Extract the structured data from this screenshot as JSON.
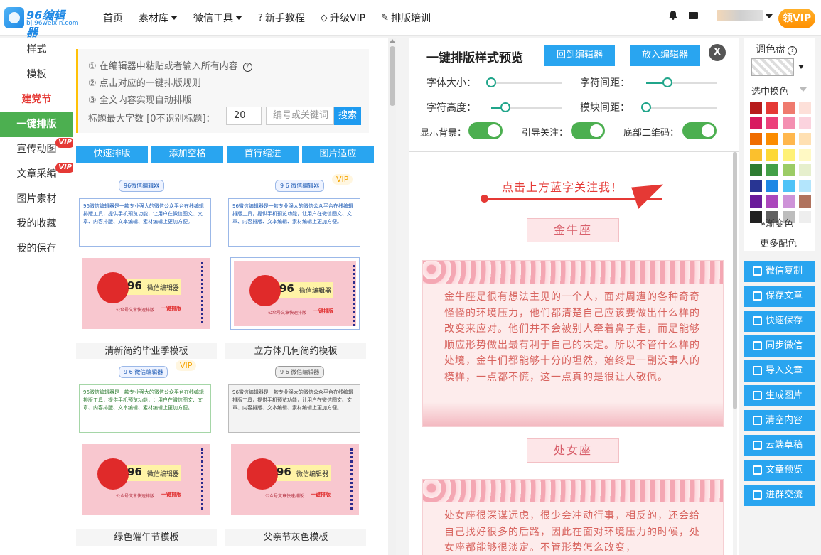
{
  "header": {
    "logo_title": "96编辑器",
    "logo_sub": "bj.96weixin.com",
    "nav": [
      {
        "label": "首页",
        "icon": "",
        "dropdown": false
      },
      {
        "label": "素材库",
        "icon": "",
        "dropdown": true
      },
      {
        "label": "微信工具",
        "icon": "",
        "dropdown": true
      },
      {
        "label": "新手教程",
        "icon": "question-icon",
        "dropdown": false
      },
      {
        "label": "升级VIP",
        "icon": "diamond-icon",
        "dropdown": false
      },
      {
        "label": "排版培训",
        "icon": "edit-icon",
        "dropdown": false
      }
    ],
    "vip_button": "领VIP"
  },
  "sidebar": {
    "items": [
      {
        "label": "样式",
        "state": "normal",
        "vip": false
      },
      {
        "label": "模板",
        "state": "normal",
        "vip": false
      },
      {
        "label": "建党节",
        "state": "highlight",
        "vip": false
      },
      {
        "label": "一键排版",
        "state": "active",
        "vip": false
      },
      {
        "label": "宣传动图",
        "state": "normal",
        "vip": true
      },
      {
        "label": "文章采编",
        "state": "normal",
        "vip": true
      },
      {
        "label": "图片素材",
        "state": "normal",
        "vip": false
      },
      {
        "label": "我的收藏",
        "state": "normal",
        "vip": false
      },
      {
        "label": "我的保存",
        "state": "normal",
        "vip": false
      }
    ],
    "vip_tag": "VIP"
  },
  "templates": {
    "hints": [
      "① 在编辑器中粘贴或者输入所有内容",
      "② 点击对应的一键排版规则",
      "③ 全文内容实现自动排版"
    ],
    "max_label": "标题最大字数 [0不识别标题]：",
    "max_value": "20",
    "keyword_placeholder": "编号或关键词",
    "search_label": "搜索",
    "quick_buttons": [
      "快速排版",
      "添加空格",
      "首行缩进",
      "图片适应"
    ],
    "vip_label": "VIP",
    "poster": {
      "num": "96",
      "name": "微信编辑器",
      "sub": "公众号文章快速排版",
      "tag": "一键排版",
      "head": "96微信编辑器",
      "head_spaced": "9 6 微信编辑器",
      "blurb": "96微信编辑器是一款专业强大的微信公众平台在线编辑排版工具，提供手机预览功能，让用户在微信图文、文章、内容排版、文本编辑、素材编辑上更加方便。"
    },
    "cards": [
      {
        "title": "清新简约毕业季模板",
        "vip": false
      },
      {
        "title": "立方体几何简约模板",
        "vip": true
      },
      {
        "title": "绿色端午节模板",
        "vip": true
      },
      {
        "title": "父亲节灰色模板",
        "vip": false
      }
    ]
  },
  "preview": {
    "title": "一键排版样式预览",
    "back_button": "回到编辑器",
    "insert_button": "放入编辑器",
    "close": "X",
    "sliders": [
      {
        "label": "字体大小：",
        "value": 0.0
      },
      {
        "label": "字符间距：",
        "value": 0.3
      },
      {
        "label": "字符高度：",
        "value": 0.2
      },
      {
        "label": "模块间距：",
        "value": 0.0
      }
    ],
    "toggles": [
      {
        "label": "显示背景：",
        "on": true
      },
      {
        "label": "引导关注：",
        "on": true
      },
      {
        "label": "底部二维码：",
        "on": true
      }
    ],
    "follow_text": "点击上方蓝字关注我！",
    "sections": [
      {
        "sign": "金牛座",
        "text": "金牛座是很有想法主见的一个人，面对周遭的各种奇奇怪怪的环境压力，他们都清楚自己应该要做出什么样的改变来应对。他们并不会被别人牵着鼻子走，而是能够顺应形势做出最有利于自己的决定。所以不管什么样的处境，金牛们都能够十分的坦然，始终是一副没事人的模样，一点都不慌，这一点真的是很让人敬佩。"
      },
      {
        "sign": "处女座",
        "text": "处女座很深谋远虑，很少会冲动行事，相反的，还会给自己找好很多的后路，因此在面对环境压力的时候，处女座都能够很淡定。不管形势怎么改变，"
      }
    ]
  },
  "palette": {
    "title": "调色盘",
    "select_label": "选中换色",
    "gradient_label": "渐变色",
    "more_label": "更多配色",
    "colors": [
      "#b71c1c",
      "#e53935",
      "#ef7a6e",
      "#fde0d9",
      "#d81b60",
      "#ec407a",
      "#f48fb1",
      "#fbd3de",
      "#ef6c00",
      "#fb8c00",
      "#ffb74d",
      "#ffe0b2",
      "#fbc02d",
      "#fdd835",
      "#fff176",
      "#fff9c4",
      "#2e7d32",
      "#43a047",
      "#9ccc65",
      "#e6efcd",
      "#283593",
      "#1e88e5",
      "#4fc3f7",
      "#b3e5fc",
      "#6a1b9a",
      "#ab47bc",
      "#ce93d8",
      "#b0735e",
      "#212121",
      "#616161",
      "#bdbdbd",
      "#eeeeee"
    ]
  },
  "tools": [
    "微信复制",
    "保存文章",
    "快速保存",
    "同步微信",
    "导入文章",
    "生成图片",
    "清空内容",
    "云端草稿",
    "文章预览",
    "进群交流"
  ]
}
